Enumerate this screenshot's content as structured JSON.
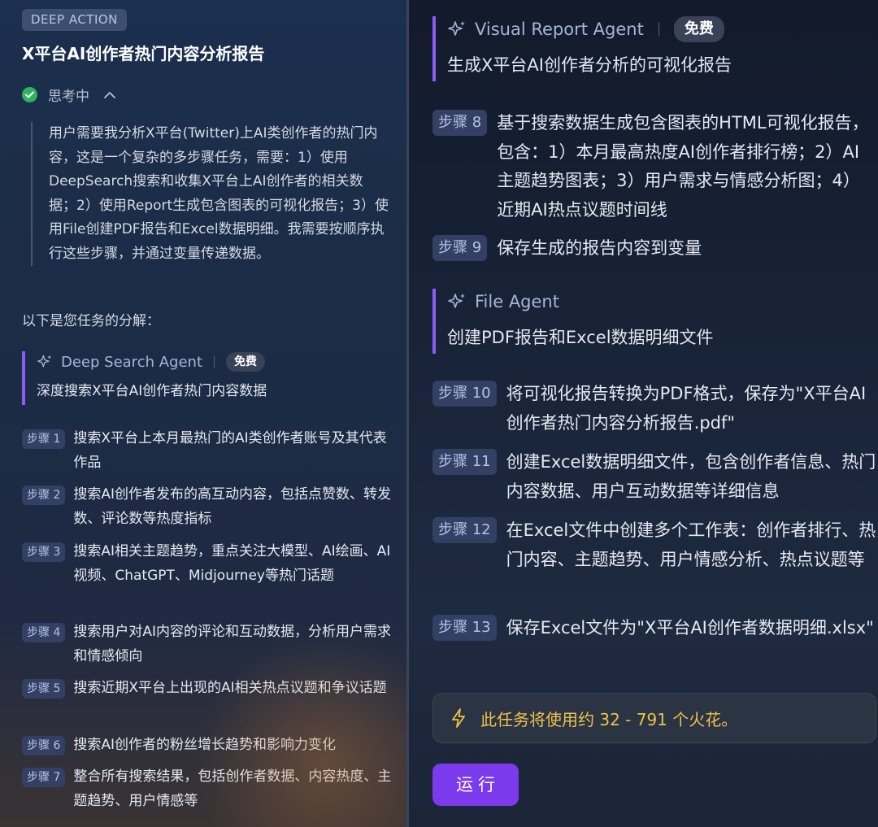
{
  "header": {
    "badge": "DEEP ACTION",
    "title": "X平台AI创作者热门内容分析报告"
  },
  "thinking": {
    "label": "思考中",
    "content": "用户需要我分析X平台(Twitter)上AI类创作者的热门内容，这是一个复杂的多步骤任务，需要：1）使用DeepSearch搜索和收集X平台上AI创作者的相关数据；2）使用Report生成包含图表的可视化报告；3）使用File创建PDF报告和Excel数据明细。我需要按顺序执行这些步骤，并通过变量传递数据。"
  },
  "breakdown_label": "以下是您任务的分解：",
  "agents": [
    {
      "name": "Deep Search Agent",
      "badge": "免费",
      "desc": "深度搜索X平台AI创作者热门内容数据",
      "steps": [
        {
          "tag": "步骤 1",
          "text": "搜索X平台上本月最热门的AI类创作者账号及其代表作品"
        },
        {
          "tag": "步骤 2",
          "text": "搜索AI创作者发布的高互动内容，包括点赞数、转发数、评论数等热度指标"
        },
        {
          "tag": "步骤 3",
          "text": "搜索AI相关主题趋势，重点关注大模型、AI绘画、AI视频、ChatGPT、Midjourney等热门话题"
        },
        {
          "tag": "步骤 4",
          "text": "搜索用户对AI内容的评论和互动数据，分析用户需求和情感倾向"
        },
        {
          "tag": "步骤 5",
          "text": "搜索近期X平台上出现的AI相关热点议题和争议话题"
        },
        {
          "tag": "步骤 6",
          "text": "搜索AI创作者的粉丝增长趋势和影响力变化"
        },
        {
          "tag": "步骤 7",
          "text": "整合所有搜索结果，包括创作者数据、内容热度、主题趋势、用户情感等"
        }
      ]
    },
    {
      "name": "Visual Report Agent",
      "badge": "免费",
      "desc": "生成X平台AI创作者分析的可视化报告",
      "steps": [
        {
          "tag": "步骤 8",
          "text": "基于搜索数据生成包含图表的HTML可视化报告，包含：1）本月最高热度AI创作者排行榜；2）AI主题趋势图表；3）用户需求与情感分析图；4）近期AI热点议题时间线"
        },
        {
          "tag": "步骤 9",
          "text": "保存生成的报告内容到变量"
        }
      ]
    },
    {
      "name": "File Agent",
      "desc": "创建PDF报告和Excel数据明细文件",
      "steps": [
        {
          "tag": "步骤 10",
          "text": "将可视化报告转换为PDF格式，保存为\"X平台AI创作者热门内容分析报告.pdf\""
        },
        {
          "tag": "步骤 11",
          "text": "创建Excel数据明细文件，包含创作者信息、热门内容数据、用户互动数据等详细信息"
        },
        {
          "tag": "步骤 12",
          "text": "在Excel文件中创建多个工作表：创作者排行、热门内容、主题趋势、用户情感分析、热点议题等"
        },
        {
          "tag": "步骤 13",
          "text": "保存Excel文件为\"X平台AI创作者数据明细.xlsx\""
        }
      ]
    }
  ],
  "notice": "此任务将使用约 32 - 791 个火花。",
  "run_button": "运行",
  "icons": {
    "check": "check-circle-icon",
    "chevron": "chevron-up-icon",
    "sparkle": "sparkle-icon",
    "bolt": "lightning-bolt-icon"
  },
  "colors": {
    "accent": "#8b5cf6",
    "run_button": "#7c3aed",
    "notice_text": "#f0c24c",
    "check": "#2fb45e"
  }
}
